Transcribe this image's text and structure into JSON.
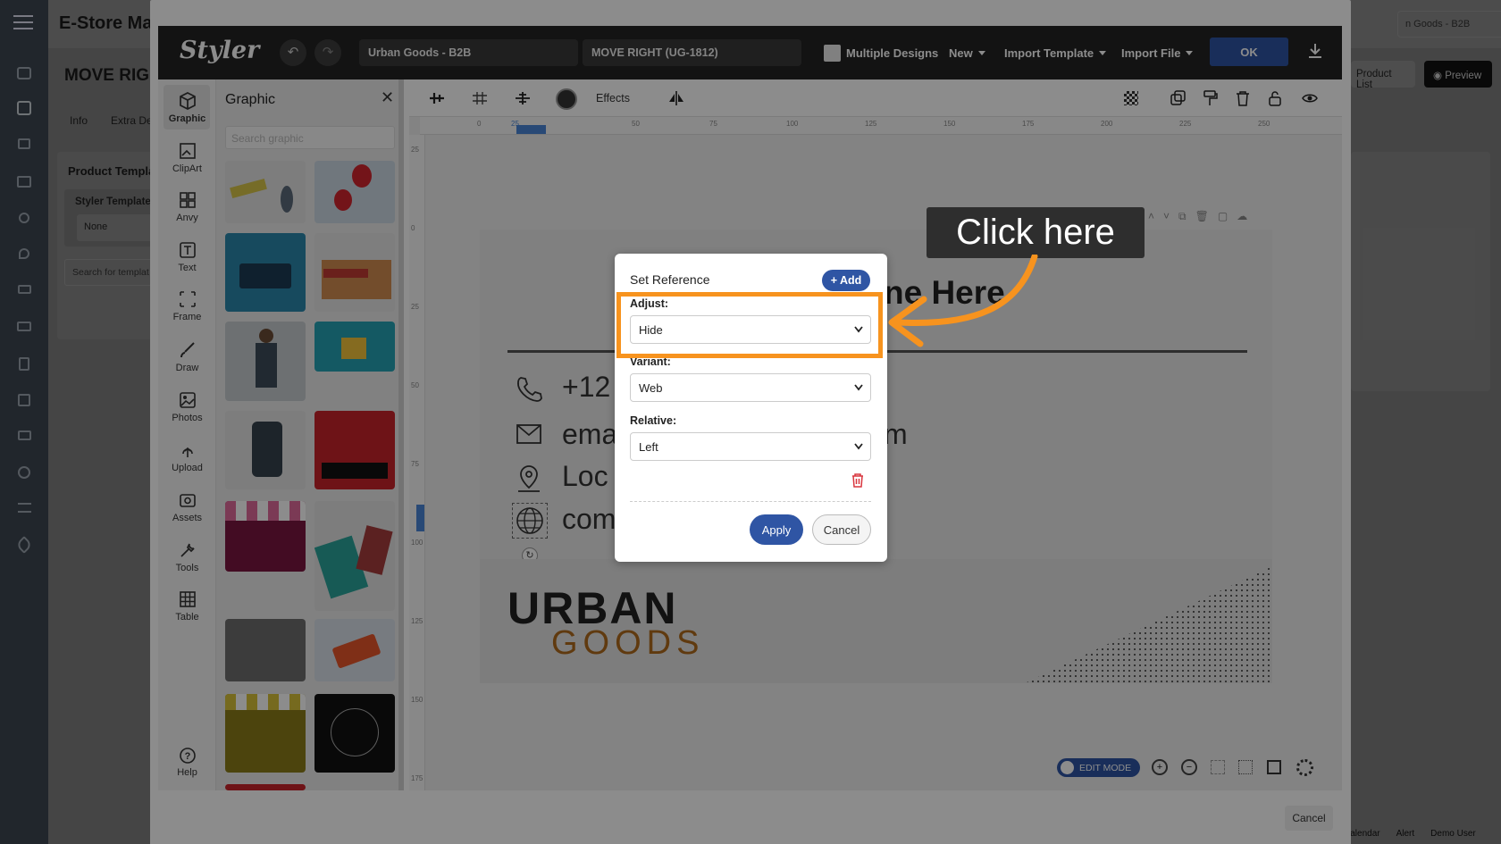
{
  "background_app": {
    "title": "E-Store Mar",
    "page_heading": "MOVE RIGH",
    "tabs": [
      "Info",
      "Extra De"
    ],
    "card_title": "Product Templa",
    "styler_template_label": "Styler Template",
    "styler_template_value": "None",
    "search_placeholder": "Search for templat",
    "store_select": "n Goods - B2B",
    "product_list_btn": "Product List",
    "preview_btn": "Preview",
    "collapse": "–",
    "footer_items": [
      "Calendar",
      "Alert",
      "Demo User"
    ]
  },
  "styler": {
    "logo": "Styler",
    "store_name": "Urban Goods - B2B",
    "design_name": "MOVE RIGHT (UG-1812)",
    "multiple_designs_label": "Multiple Designs",
    "new_menu": "New",
    "import_template_menu": "Import Template",
    "import_file_menu": "Import File",
    "ok_button": "OK",
    "effects_label": "Effects",
    "tools": [
      "Graphic",
      "ClipArt",
      "Anvy",
      "Text",
      "Frame",
      "Draw",
      "Photos",
      "Upload",
      "Assets",
      "Tools",
      "Table"
    ],
    "help_label": "Help",
    "panel_title": "Graphic",
    "panel_search_placeholder": "Search graphic",
    "ruler_top_ticks": [
      "0",
      "25",
      "50",
      "75",
      "100",
      "125",
      "150",
      "175",
      "200",
      "225",
      "250"
    ],
    "ruler_left_ticks": [
      "25",
      "0",
      "25",
      "50",
      "75",
      "100",
      "125",
      "150",
      "175"
    ],
    "edit_mode_label": "EDIT MODE",
    "cancel_button": "Cancel"
  },
  "design": {
    "name_heading": "ne Here",
    "phone": "+12",
    "email": "ema",
    "email_tail": "m",
    "location": "Loc",
    "website": "com",
    "brand_line1": "URBAN",
    "brand_line2": "GOODS"
  },
  "popup": {
    "title": "Set Reference",
    "add_button": "+ Add",
    "adjust_label": "Adjust:",
    "adjust_value": "Hide",
    "variant_label": "Variant:",
    "variant_value": "Web",
    "relative_label": "Relative:",
    "relative_value": "Left",
    "apply_button": "Apply",
    "cancel_button": "Cancel"
  },
  "callout": {
    "text": "Click here"
  },
  "colors": {
    "accent_blue": "#2f55a4",
    "highlight_orange": "#f7931e",
    "topbar_dark": "#232323",
    "delete_red": "#d9363e"
  }
}
